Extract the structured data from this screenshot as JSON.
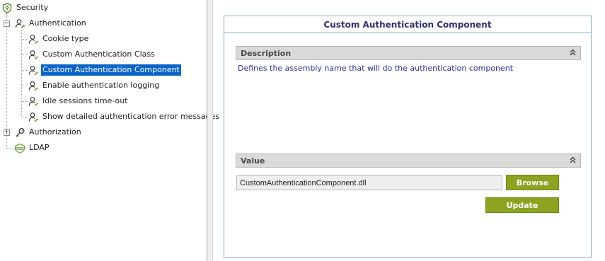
{
  "tree": {
    "root": {
      "label": "Security",
      "icon": "shield-icon"
    },
    "authentication": {
      "label": "Authentication",
      "expander": "−",
      "children": [
        {
          "label": "Cookie type"
        },
        {
          "label": "Custom Authentication Class"
        },
        {
          "label": "Custom Authentication Component",
          "selected": true
        },
        {
          "label": "Enable authentication logging"
        },
        {
          "label": "Idle sessions time-out"
        },
        {
          "label": "Show detailed authentication error messages"
        }
      ]
    },
    "authorization": {
      "label": "Authorization",
      "expander": "+"
    },
    "ldap": {
      "label": "LDAP"
    }
  },
  "panel": {
    "title": "Custom Authentication Component",
    "description_section": {
      "label": "Description",
      "text": "Defines the assembly name that will do the authentication component"
    },
    "value_section": {
      "label": "Value",
      "input_value": "CustomAuthenticationComponent.dll"
    },
    "browse_label": "Browse",
    "update_label": "Update"
  },
  "colors": {
    "selection": "#0a64c8",
    "accent_button": "#8ba321",
    "title_text": "#2c2f6e",
    "description_text": "#2c2f8f",
    "node_icon": "#4a7c2a"
  }
}
